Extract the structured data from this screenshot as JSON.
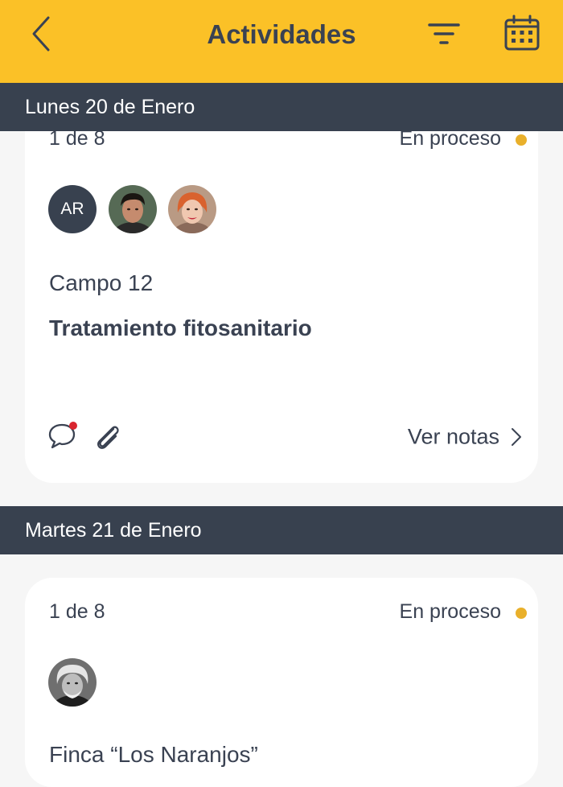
{
  "header": {
    "title": "Actividades",
    "background": "#fbc127",
    "back_icon": "chevron-left-icon",
    "filter_icon": "filter-icon",
    "calendar_icon": "calendar-icon"
  },
  "days": [
    {
      "label": "Lunes 20 de Enero",
      "card": {
        "count": "1 de 8",
        "status": "En proceso",
        "status_color": "#e9b02b",
        "avatars": [
          {
            "type": "initials",
            "text": "AR"
          },
          {
            "type": "photo",
            "icon": "person-photo-icon"
          },
          {
            "type": "photo",
            "icon": "person-photo-icon"
          }
        ],
        "field": "Campo 12",
        "task": "Tratamiento fitosanitario",
        "comment_icon": "comment-icon",
        "has_unread": true,
        "attachment_icon": "paperclip-icon",
        "notes_label": "Ver notas"
      }
    },
    {
      "label": "Martes 21 de Enero",
      "card": {
        "count": "1 de 8",
        "status": "En proceso",
        "status_color": "#e9b02b",
        "avatars": [
          {
            "type": "photo",
            "icon": "person-photo-icon"
          }
        ],
        "field_partial": "Finca “Los Naranjos”"
      }
    }
  ]
}
